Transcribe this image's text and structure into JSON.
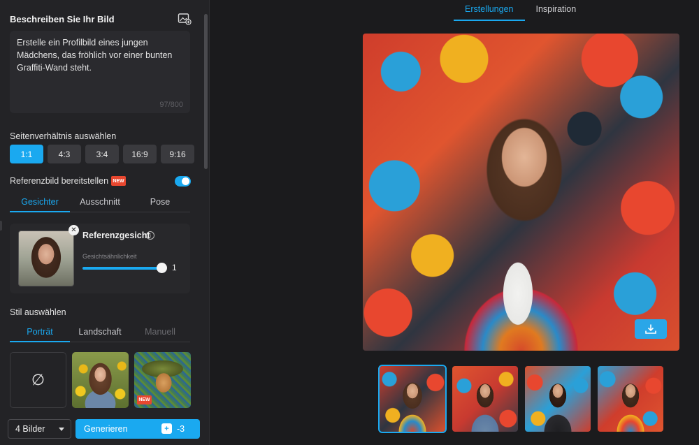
{
  "prompt_section": {
    "title": "Beschreiben Sie Ihr Bild",
    "text": "Erstelle ein Profilbild eines jungen Mädchens, das fröhlich vor einer bunten Graffiti-Wand steht.",
    "char_count": "97/800"
  },
  "aspect_ratio": {
    "title": "Seitenverhältnis auswählen",
    "options": [
      "1:1",
      "4:3",
      "3:4",
      "16:9",
      "9:16"
    ],
    "selected": "1:1"
  },
  "reference": {
    "title": "Referenzbild bereitstellen",
    "badge": "NEW",
    "enabled": true,
    "tabs": [
      "Gesichter",
      "Ausschnitt",
      "Pose"
    ],
    "active_tab": "Gesichter",
    "face_title": "Referenzgesicht",
    "similarity_label": "Gesichtsähnlichkeit",
    "similarity_value": "1",
    "close_symbol": "✕",
    "info_symbol": "i"
  },
  "style": {
    "title": "Stil auswählen",
    "tabs": [
      "Porträt",
      "Landschaft",
      "Manuell"
    ],
    "active_tab": "Porträt",
    "none_symbol": "∅",
    "new_badge": "NEW"
  },
  "footer": {
    "count_label": "4 Bilder",
    "generate_label": "Generieren",
    "credit_symbol": "+",
    "credit_cost": "-3"
  },
  "top_tabs": [
    "Erstellungen",
    "Inspiration"
  ],
  "active_top_tab": "Erstellungen",
  "colors": {
    "accent": "#1aa9f0",
    "badge": "#e8472f",
    "panel": "#232326",
    "background": "#1b1b1d"
  }
}
